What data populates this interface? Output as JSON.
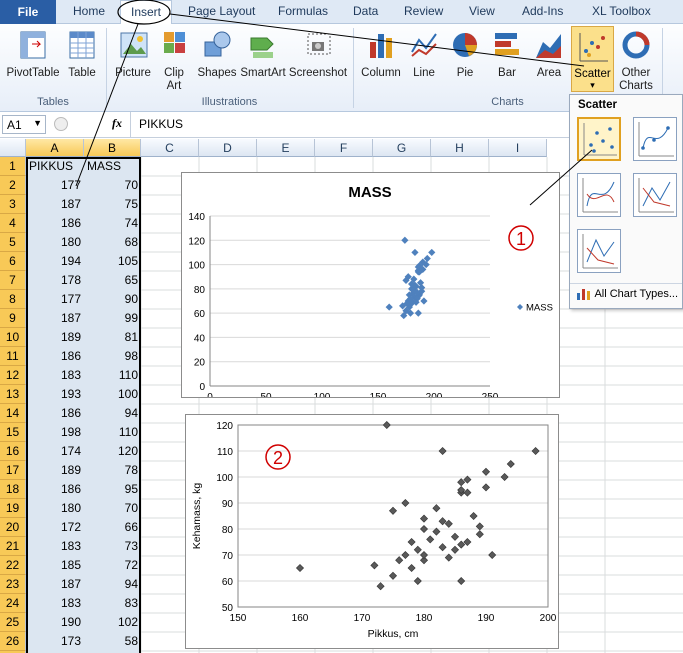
{
  "tabs": [
    "File",
    "Home",
    "Insert",
    "Page Layout",
    "Formulas",
    "Data",
    "Review",
    "View",
    "Add-Ins",
    "XL Toolbox"
  ],
  "ribbon": {
    "buttons": {
      "pivot": "PivotTable",
      "table": "Table",
      "picture": "Picture",
      "clip1": "Clip",
      "clip2": "Art",
      "shapes": "Shapes",
      "smartart": "SmartArt",
      "screenshot": "Screenshot",
      "column": "Column",
      "line": "Line",
      "pie": "Pie",
      "bar": "Bar",
      "area": "Area",
      "scatter": "Scatter",
      "other1": "Other",
      "other2": "Charts"
    },
    "groups": {
      "tables": "Tables",
      "illustrations": "Illustrations",
      "charts": "Charts"
    }
  },
  "formula_bar": {
    "name_box": "A1",
    "fx": "fx",
    "value": "PIKKUS"
  },
  "columns": [
    "A",
    "B",
    "C",
    "D",
    "E",
    "F",
    "G",
    "H",
    "I"
  ],
  "rows": [
    {
      "n": "1",
      "a": "PIKKUS",
      "b": "MASS"
    },
    {
      "n": "2",
      "a": "177",
      "b": "70"
    },
    {
      "n": "3",
      "a": "187",
      "b": "75"
    },
    {
      "n": "4",
      "a": "186",
      "b": "74"
    },
    {
      "n": "5",
      "a": "180",
      "b": "68"
    },
    {
      "n": "6",
      "a": "194",
      "b": "105"
    },
    {
      "n": "7",
      "a": "178",
      "b": "65"
    },
    {
      "n": "8",
      "a": "177",
      "b": "90"
    },
    {
      "n": "9",
      "a": "187",
      "b": "99"
    },
    {
      "n": "10",
      "a": "189",
      "b": "81"
    },
    {
      "n": "11",
      "a": "186",
      "b": "98"
    },
    {
      "n": "12",
      "a": "183",
      "b": "110"
    },
    {
      "n": "13",
      "a": "193",
      "b": "100"
    },
    {
      "n": "14",
      "a": "186",
      "b": "94"
    },
    {
      "n": "15",
      "a": "198",
      "b": "110"
    },
    {
      "n": "16",
      "a": "174",
      "b": "120"
    },
    {
      "n": "17",
      "a": "189",
      "b": "78"
    },
    {
      "n": "18",
      "a": "186",
      "b": "95"
    },
    {
      "n": "19",
      "a": "180",
      "b": "70"
    },
    {
      "n": "20",
      "a": "172",
      "b": "66"
    },
    {
      "n": "21",
      "a": "183",
      "b": "73"
    },
    {
      "n": "22",
      "a": "185",
      "b": "72"
    },
    {
      "n": "23",
      "a": "187",
      "b": "94"
    },
    {
      "n": "24",
      "a": "183",
      "b": "83"
    },
    {
      "n": "25",
      "a": "190",
      "b": "102"
    },
    {
      "n": "26",
      "a": "173",
      "b": "58"
    },
    {
      "n": "27",
      "a": "180",
      "b": "80"
    }
  ],
  "gallery": {
    "title": "Scatter",
    "all_types": "All Chart Types..."
  },
  "annotations": {
    "one": "1",
    "two": "2"
  },
  "chart_data": [
    {
      "type": "scatter",
      "title": "MASS",
      "xlabel": "",
      "ylabel": "",
      "xlim": [
        0,
        250
      ],
      "ylim": [
        0,
        140
      ],
      "xticks": [
        "0",
        "50",
        "100",
        "150",
        "200",
        "250"
      ],
      "yticks": [
        "0",
        "20",
        "40",
        "60",
        "80",
        "100",
        "120",
        "140"
      ],
      "legend": "MASS",
      "legend_position": "right",
      "color": "#4f81bd",
      "points": [
        [
          177,
          70
        ],
        [
          187,
          75
        ],
        [
          186,
          74
        ],
        [
          180,
          68
        ],
        [
          194,
          105
        ],
        [
          178,
          65
        ],
        [
          177,
          90
        ],
        [
          187,
          99
        ],
        [
          189,
          81
        ],
        [
          186,
          98
        ],
        [
          183,
          110
        ],
        [
          193,
          100
        ],
        [
          186,
          94
        ],
        [
          198,
          110
        ],
        [
          174,
          120
        ],
        [
          189,
          78
        ],
        [
          186,
          95
        ],
        [
          180,
          70
        ],
        [
          172,
          66
        ],
        [
          183,
          73
        ],
        [
          185,
          72
        ],
        [
          187,
          94
        ],
        [
          183,
          83
        ],
        [
          190,
          102
        ],
        [
          173,
          58
        ],
        [
          180,
          80
        ],
        [
          160,
          65
        ],
        [
          175,
          62
        ],
        [
          181,
          76
        ],
        [
          184,
          69
        ],
        [
          176,
          68
        ],
        [
          179,
          60
        ],
        [
          182,
          88
        ],
        [
          188,
          85
        ],
        [
          191,
          70
        ],
        [
          178,
          75
        ],
        [
          185,
          77
        ],
        [
          175,
          87
        ],
        [
          182,
          79
        ],
        [
          180,
          84
        ],
        [
          186,
          60
        ],
        [
          179,
          72
        ],
        [
          190,
          96
        ],
        [
          184,
          82
        ]
      ]
    },
    {
      "type": "scatter",
      "title": "",
      "xlabel": "Pikkus, cm",
      "ylabel": "Kehamass, kg",
      "xlim": [
        150,
        200
      ],
      "ylim": [
        50,
        120
      ],
      "xticks": [
        "150",
        "160",
        "170",
        "180",
        "190",
        "200"
      ],
      "yticks": [
        "50",
        "60",
        "70",
        "80",
        "90",
        "100",
        "110",
        "120"
      ],
      "color": "#595959",
      "points": [
        [
          177,
          70
        ],
        [
          187,
          75
        ],
        [
          186,
          74
        ],
        [
          180,
          68
        ],
        [
          194,
          105
        ],
        [
          178,
          65
        ],
        [
          177,
          90
        ],
        [
          187,
          99
        ],
        [
          189,
          81
        ],
        [
          186,
          98
        ],
        [
          183,
          110
        ],
        [
          193,
          100
        ],
        [
          186,
          94
        ],
        [
          198,
          110
        ],
        [
          174,
          120
        ],
        [
          189,
          78
        ],
        [
          186,
          95
        ],
        [
          180,
          70
        ],
        [
          172,
          66
        ],
        [
          183,
          73
        ],
        [
          185,
          72
        ],
        [
          187,
          94
        ],
        [
          183,
          83
        ],
        [
          190,
          102
        ],
        [
          173,
          58
        ],
        [
          180,
          80
        ],
        [
          160,
          65
        ],
        [
          175,
          62
        ],
        [
          181,
          76
        ],
        [
          184,
          69
        ],
        [
          176,
          68
        ],
        [
          179,
          60
        ],
        [
          182,
          88
        ],
        [
          188,
          85
        ],
        [
          191,
          70
        ],
        [
          178,
          75
        ],
        [
          185,
          77
        ],
        [
          175,
          87
        ],
        [
          182,
          79
        ],
        [
          180,
          84
        ],
        [
          186,
          60
        ],
        [
          179,
          72
        ],
        [
          190,
          96
        ],
        [
          184,
          82
        ]
      ]
    }
  ]
}
